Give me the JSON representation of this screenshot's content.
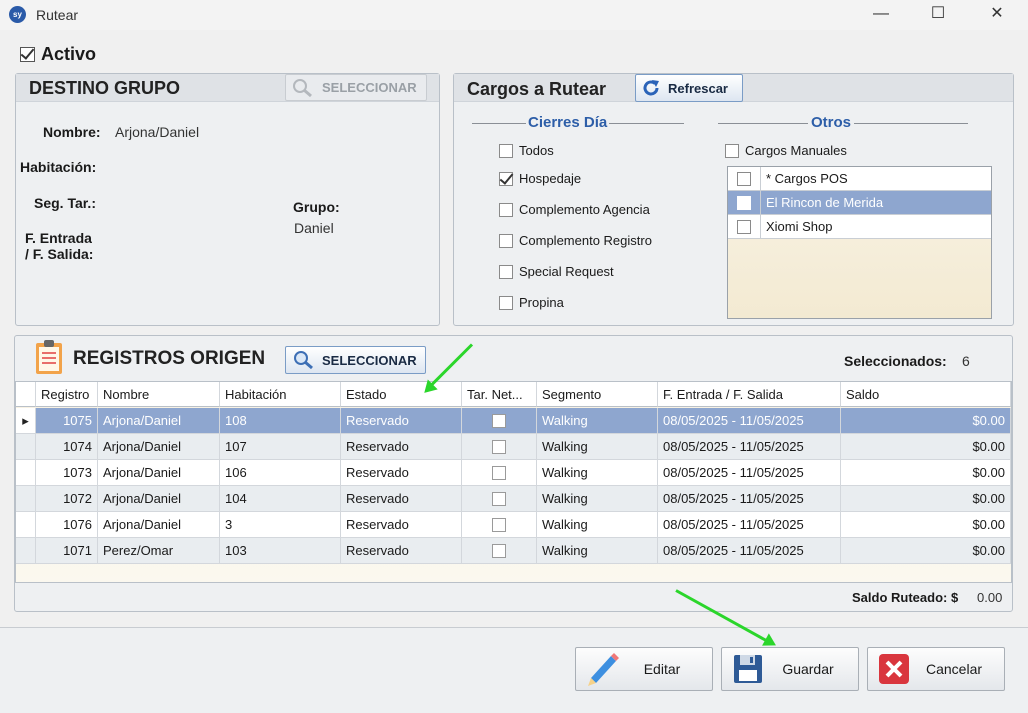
{
  "window": {
    "logo": "sy",
    "title": "Rutear",
    "minimize": "—",
    "maximize": "☐",
    "close": "✕"
  },
  "activo": {
    "label": "Activo",
    "checked": true
  },
  "destino": {
    "title": "DESTINO GRUPO",
    "select_label": "SELECCIONAR",
    "nombre_label": "Nombre:",
    "nombre_value": "Arjona/Daniel",
    "habitacion_label": "Habitación:",
    "segtar_label": "Seg. Tar.:",
    "grupo_label": "Grupo:",
    "grupo_value": "Daniel",
    "fentrada_label": "F. Entrada",
    "fsalida_label": "/ F. Salida:"
  },
  "cargos": {
    "title": "Cargos a Rutear",
    "refresh_label": "Refrescar",
    "cierres_title": "Cierres Día",
    "otros_title": "Otros",
    "cierres": [
      {
        "label": "Todos",
        "checked": false
      },
      {
        "label": "Hospedaje",
        "checked": true
      },
      {
        "label": "Complemento Agencia",
        "checked": false
      },
      {
        "label": "Complemento Registro",
        "checked": false
      },
      {
        "label": "Special Request",
        "checked": false
      },
      {
        "label": "Propina",
        "checked": false
      }
    ],
    "manuales_label": "Cargos Manuales",
    "list": [
      {
        "label": "* Cargos POS",
        "selected": false
      },
      {
        "label": "El Rincon de Merida",
        "selected": true
      },
      {
        "label": "Xiomi Shop",
        "selected": false
      }
    ]
  },
  "registros": {
    "title": "REGISTROS ORIGEN",
    "select_label": "SELECCIONAR",
    "selected_label": "Seleccionados:",
    "selected_count": "6",
    "columns": [
      "Registro",
      "Nombre",
      "Habitación",
      "Estado",
      "Tar. Net...",
      "Segmento",
      "F. Entrada / F. Salida",
      "Saldo"
    ],
    "rows": [
      {
        "registro": "1075",
        "nombre": "Arjona/Daniel",
        "habitacion": "108",
        "estado": "Reservado",
        "tarnet": false,
        "segmento": "Walking",
        "fechas": "08/05/2025 - 11/05/2025",
        "saldo": "$0.00"
      },
      {
        "registro": "1074",
        "nombre": "Arjona/Daniel",
        "habitacion": "107",
        "estado": "Reservado",
        "tarnet": false,
        "segmento": "Walking",
        "fechas": "08/05/2025 - 11/05/2025",
        "saldo": "$0.00"
      },
      {
        "registro": "1073",
        "nombre": "Arjona/Daniel",
        "habitacion": "106",
        "estado": "Reservado",
        "tarnet": false,
        "segmento": "Walking",
        "fechas": "08/05/2025 - 11/05/2025",
        "saldo": "$0.00"
      },
      {
        "registro": "1072",
        "nombre": "Arjona/Daniel",
        "habitacion": "104",
        "estado": "Reservado",
        "tarnet": false,
        "segmento": "Walking",
        "fechas": "08/05/2025 - 11/05/2025",
        "saldo": "$0.00"
      },
      {
        "registro": "1076",
        "nombre": "Arjona/Daniel",
        "habitacion": "3",
        "estado": "Reservado",
        "tarnet": false,
        "segmento": "Walking",
        "fechas": "08/05/2025 - 11/05/2025",
        "saldo": "$0.00"
      },
      {
        "registro": "1071",
        "nombre": "Perez/Omar",
        "habitacion": "103",
        "estado": "Reservado",
        "tarnet": false,
        "segmento": "Walking",
        "fechas": "08/05/2025 - 11/05/2025",
        "saldo": "$0.00"
      }
    ],
    "saldo_label": "Saldo Ruteado: $",
    "saldo_value": "0.00"
  },
  "actions": {
    "editar": "Editar",
    "guardar": "Guardar",
    "cancelar": "Cancelar"
  },
  "colors": {
    "selection": "#8ea6cf",
    "section_title": "#2d5ea8",
    "annotation_arrow": "#2bd62b"
  }
}
